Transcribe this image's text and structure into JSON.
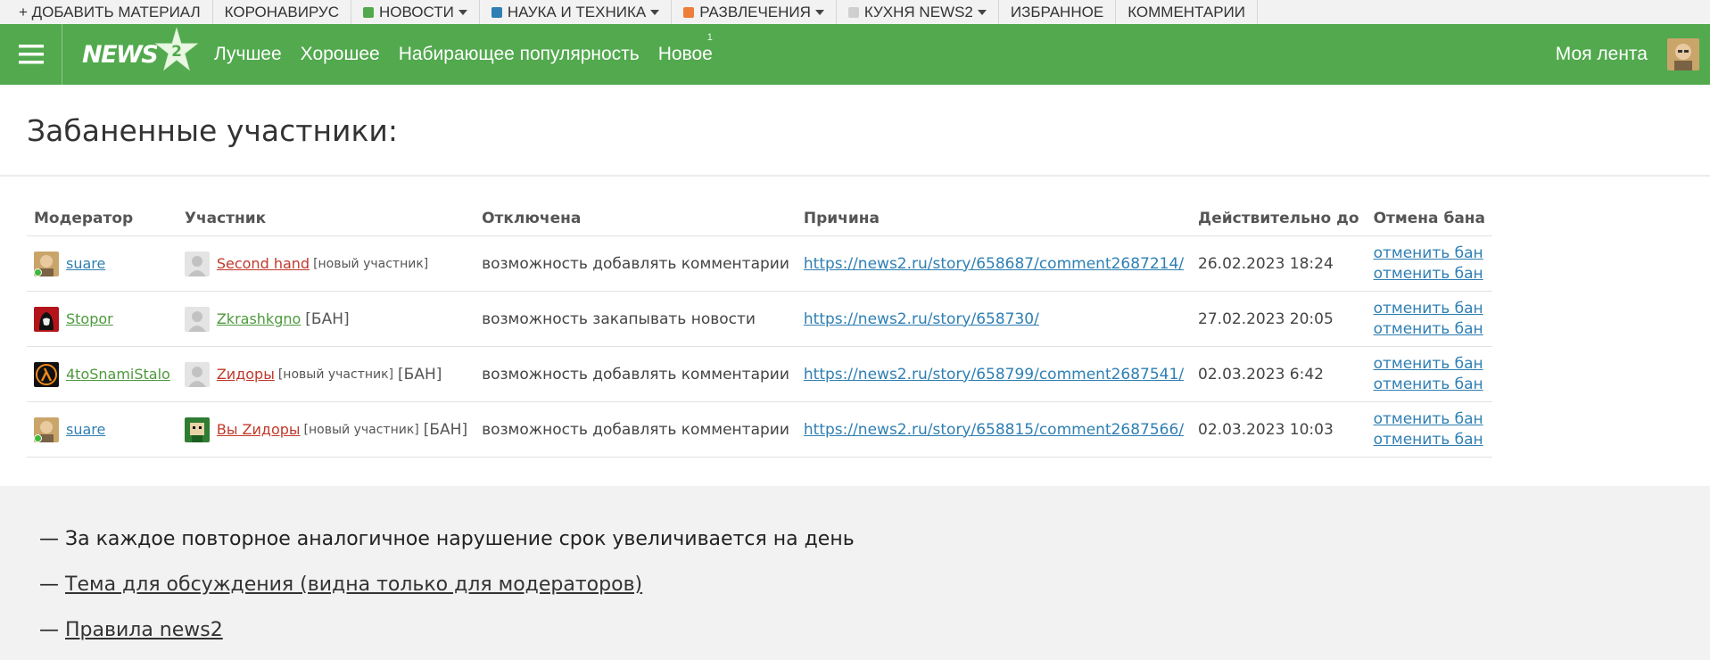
{
  "topbar": {
    "add_material": "+ ДОБАВИТЬ МАТЕРИАЛ",
    "coronavirus": "КОРОНАВИРУС",
    "news": {
      "label": "НОВОСТИ",
      "color": "#52a94e"
    },
    "science": {
      "label": "НАУКА И ТЕХНИКА",
      "color": "#2f7fb3"
    },
    "fun": {
      "label": "РАЗВЛЕЧЕНИЯ",
      "color": "#ee7d3b"
    },
    "kitchen": {
      "label": "КУХНЯ NEWS2",
      "color": "#cfcfcf"
    },
    "favorites": "ИЗБРАННОЕ",
    "comments": "КОММЕНТАРИИ"
  },
  "header": {
    "logo_text": "NEWS",
    "nav": {
      "best": "Лучшее",
      "good": "Хорошее",
      "rising": "Набирающее популярность",
      "new": "Новое",
      "new_count": "1"
    },
    "my_feed": "Моя лента",
    "brand_color": "#52a94e"
  },
  "page": {
    "title": "Забаненные участники:"
  },
  "table": {
    "headers": {
      "moderator": "Модератор",
      "member": "Участник",
      "disabled": "Отключена",
      "reason": "Причина",
      "valid_until": "Действительно до",
      "cancel": "Отмена бана"
    },
    "rows": [
      {
        "moderator": "suare",
        "member": "Second hand",
        "member_tag": "[новый участник]",
        "ban_tag": "",
        "disabled": "возможность добавлять комментарии",
        "reason": "https://news2.ru/story/658687/comment2687214/",
        "until": "26.02.2023 18:24",
        "cancel1": "отменить бан",
        "cancel2": "отменить бан"
      },
      {
        "moderator": "Stopor",
        "member": "Zkrashkgno",
        "member_tag": "",
        "ban_tag": "[БАН]",
        "disabled": "возможность закапывать новости",
        "reason": "https://news2.ru/story/658730/",
        "until": "27.02.2023 20:05",
        "cancel1": "отменить бан",
        "cancel2": "отменить бан"
      },
      {
        "moderator": "4toSnamiStalo",
        "member": "Zидоры",
        "member_tag": "[новый участник]",
        "ban_tag": "[БАН]",
        "disabled": "возможность добавлять комментарии",
        "reason": "https://news2.ru/story/658799/comment2687541/",
        "until": "02.03.2023 6:42",
        "cancel1": "отменить бан",
        "cancel2": "отменить бан"
      },
      {
        "moderator": "suare",
        "member": "Вы Zидоры",
        "member_tag": "[новый участник]",
        "ban_tag": "[БАН]",
        "disabled": "возможность добавлять комментарии",
        "reason": "https://news2.ru/story/658815/comment2687566/",
        "until": "02.03.2023 10:03",
        "cancel1": "отменить бан",
        "cancel2": "отменить бан"
      }
    ]
  },
  "notes": {
    "dash": "—",
    "repeat_rule": "За каждое повторное аналогичное нарушение срок увеличивается на день",
    "topic_link": "Тема для обсуждения (видна только для модераторов)",
    "rules_link": "Правила news2"
  },
  "icons": {
    "menu": "hamburger-icon",
    "logo_badge": "star-2-icon",
    "caret": "caret-down-icon"
  }
}
